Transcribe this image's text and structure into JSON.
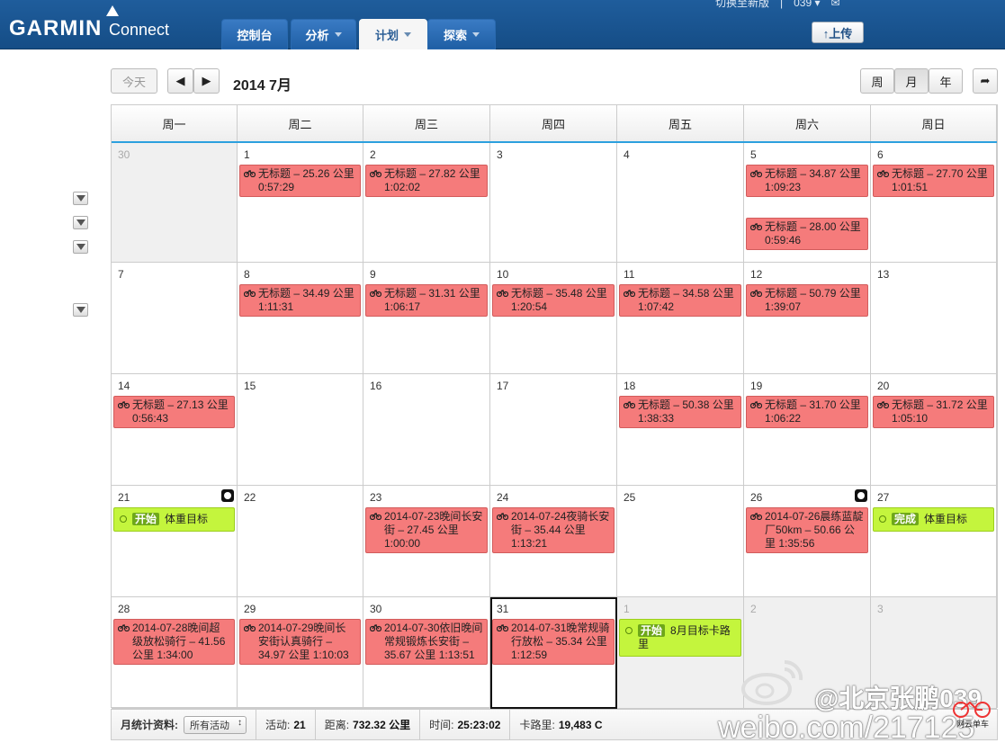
{
  "header": {
    "brand": "GARMIN",
    "brand_sub": "Connect",
    "top_link": "切换至新版　|　039 ▾　✉",
    "tabs": [
      {
        "label": "控制台",
        "active": false,
        "dropdown": false
      },
      {
        "label": "分析",
        "active": false,
        "dropdown": true
      },
      {
        "label": "计划",
        "active": true,
        "dropdown": true
      },
      {
        "label": "探索",
        "active": false,
        "dropdown": true
      }
    ],
    "upload_label": "↑上传"
  },
  "toolbar": {
    "today_label": "今天",
    "prev_icon": "◀",
    "next_icon": "▶",
    "month_title": "2014 7月",
    "view_week": "周",
    "view_month": "月",
    "view_year": "年",
    "share_icon": "➦"
  },
  "weekdays": [
    "周一",
    "周二",
    "周三",
    "周四",
    "周五",
    "周六",
    "周日"
  ],
  "weeks": [
    [
      {
        "day": "30",
        "muted": true,
        "items": []
      },
      {
        "day": "1",
        "items": [
          {
            "type": "ride",
            "text": "无标题 – 25.26 公里 0:57:29"
          }
        ]
      },
      {
        "day": "2",
        "items": [
          {
            "type": "ride",
            "text": "无标题 – 27.82 公里 1:02:02"
          }
        ]
      },
      {
        "day": "3",
        "items": []
      },
      {
        "day": "4",
        "items": []
      },
      {
        "day": "5",
        "items": [
          {
            "type": "ride",
            "text": "无标题 – 34.87 公里 1:09:23"
          },
          {
            "type": "ride",
            "text": "无标题 – 28.00 公里 0:59:46"
          }
        ]
      },
      {
        "day": "6",
        "items": [
          {
            "type": "ride",
            "text": "无标题 – 27.70 公里 1:01:51"
          }
        ]
      }
    ],
    [
      {
        "day": "7",
        "items": []
      },
      {
        "day": "8",
        "items": [
          {
            "type": "ride",
            "text": "无标题 – 34.49 公里 1:11:31"
          }
        ]
      },
      {
        "day": "9",
        "items": [
          {
            "type": "ride",
            "text": "无标题 – 31.31 公里 1:06:17"
          }
        ]
      },
      {
        "day": "10",
        "items": [
          {
            "type": "ride",
            "text": "无标题 – 35.48 公里 1:20:54"
          }
        ]
      },
      {
        "day": "11",
        "items": [
          {
            "type": "ride",
            "text": "无标题 – 34.58 公里 1:07:42"
          }
        ]
      },
      {
        "day": "12",
        "items": [
          {
            "type": "ride",
            "text": "无标题 – 50.79 公里 1:39:07"
          }
        ]
      },
      {
        "day": "13",
        "items": []
      }
    ],
    [
      {
        "day": "14",
        "items": [
          {
            "type": "ride",
            "text": "无标题 – 27.13 公里 0:56:43"
          }
        ]
      },
      {
        "day": "15",
        "items": []
      },
      {
        "day": "16",
        "items": []
      },
      {
        "day": "17",
        "items": []
      },
      {
        "day": "18",
        "items": [
          {
            "type": "ride",
            "text": "无标题 – 50.38 公里 1:38:33"
          }
        ]
      },
      {
        "day": "19",
        "items": [
          {
            "type": "ride",
            "text": "无标题 – 31.70 公里 1:06:22"
          }
        ]
      },
      {
        "day": "20",
        "items": [
          {
            "type": "ride",
            "text": "无标题 – 31.72 公里 1:05:10"
          }
        ]
      }
    ],
    [
      {
        "day": "21",
        "scale": true,
        "items": [
          {
            "type": "goal",
            "tag": "开始",
            "text": "体重目标"
          }
        ]
      },
      {
        "day": "22",
        "items": []
      },
      {
        "day": "23",
        "items": [
          {
            "type": "ride",
            "text": "2014-07-23晚间长安街 – 27.45 公里 1:00:00"
          }
        ]
      },
      {
        "day": "24",
        "items": [
          {
            "type": "ride",
            "text": "2014-07-24夜骑长安街 – 35.44 公里 1:13:21"
          }
        ]
      },
      {
        "day": "25",
        "items": []
      },
      {
        "day": "26",
        "scale": true,
        "items": [
          {
            "type": "ride",
            "text": "2014-07-26晨练蓝靛厂50km – 50.66 公里 1:35:56"
          }
        ]
      },
      {
        "day": "27",
        "items": [
          {
            "type": "goal",
            "tag": "完成",
            "text": "体重目标"
          }
        ]
      }
    ],
    [
      {
        "day": "28",
        "items": [
          {
            "type": "ride",
            "text": "2014-07-28晚间超级放松骑行 – 41.56 公里 1:34:00"
          }
        ]
      },
      {
        "day": "29",
        "items": [
          {
            "type": "ride",
            "text": "2014-07-29晚间长安街认真骑行 – 34.97 公里 1:10:03"
          }
        ]
      },
      {
        "day": "30",
        "items": [
          {
            "type": "ride",
            "text": "2014-07-30依旧晚间常规锻炼长安街 – 35.67 公里 1:13:51"
          }
        ]
      },
      {
        "day": "31",
        "today": true,
        "items": [
          {
            "type": "ride",
            "text": "2014-07-31晚常规骑行放松 – 35.34 公里 1:12:59"
          }
        ]
      },
      {
        "day": "1",
        "muted": true,
        "items": [
          {
            "type": "goal",
            "tag": "开始",
            "text": "8月目标卡路里"
          }
        ]
      },
      {
        "day": "2",
        "muted": true,
        "items": []
      },
      {
        "day": "3",
        "muted": true,
        "items": []
      }
    ]
  ],
  "footer": {
    "stats_label": "月统计资料:",
    "filter_value": "所有活动",
    "activities_label": "活动:",
    "activities_value": "21",
    "distance_label": "距离:",
    "distance_value": "732.32 公里",
    "time_label": "时间:",
    "time_value": "25:23:02",
    "calories_label": "卡路里:",
    "calories_value": "19,483 C"
  },
  "watermark": {
    "line1": "@北京张鹏039",
    "line2": "weibo.com/217125",
    "logo_text": "网云单车"
  },
  "colors": {
    "ride": "#f57b7b",
    "goal": "#c4f53d",
    "accent_line": "#2ca0de",
    "header": "#1f5d9c"
  }
}
